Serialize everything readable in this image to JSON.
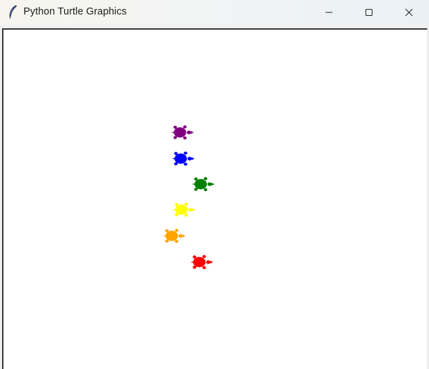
{
  "window": {
    "title": "Python Turtle Graphics",
    "app_icon": "feather-icon",
    "controls": {
      "minimize_icon": "minimize-icon",
      "maximize_icon": "maximize-icon",
      "close_icon": "close-icon"
    }
  },
  "canvas": {
    "background": "#ffffff",
    "turtles": [
      {
        "name": "turtle-purple",
        "color": "#800080",
        "icon": "turtle-icon"
      },
      {
        "name": "turtle-blue",
        "color": "#0000ff",
        "icon": "turtle-icon"
      },
      {
        "name": "turtle-green",
        "color": "#008000",
        "icon": "turtle-icon"
      },
      {
        "name": "turtle-yellow",
        "color": "#ffff00",
        "icon": "turtle-icon"
      },
      {
        "name": "turtle-orange",
        "color": "#ffa500",
        "icon": "turtle-icon"
      },
      {
        "name": "turtle-red",
        "color": "#ff0000",
        "icon": "turtle-icon"
      }
    ]
  }
}
